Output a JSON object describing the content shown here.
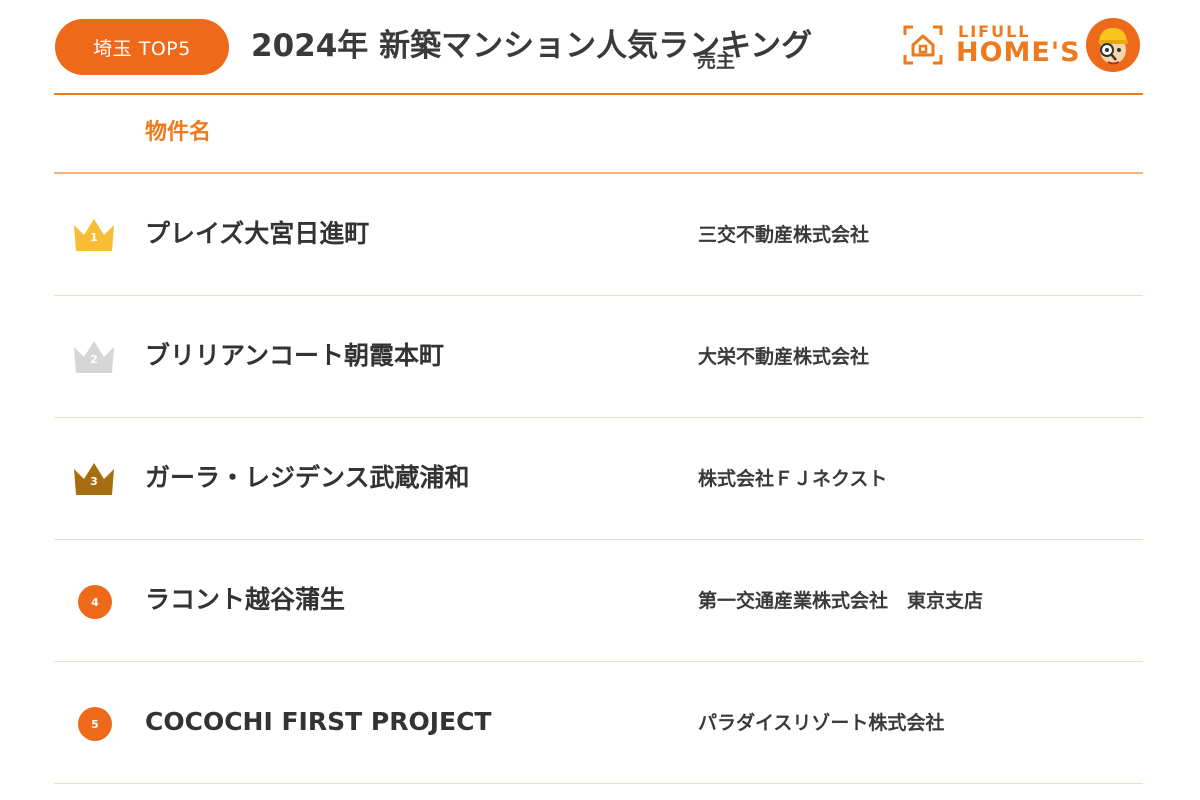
{
  "header": {
    "badge": "埼玉 TOP5",
    "title": "2024年 新築マンション人気ランキング",
    "logo_top": "LIFULL",
    "logo_main": "HOME'S"
  },
  "table": {
    "col_name": "物件名",
    "col_seller": "売主",
    "rows": [
      {
        "rank": "1",
        "marker": "gold-crown",
        "name": "プレイズ大宮日進町",
        "seller": "三交不動産株式会社"
      },
      {
        "rank": "2",
        "marker": "silver-crown",
        "name": "ブリリアンコート朝霞本町",
        "seller": "大栄不動産株式会社"
      },
      {
        "rank": "3",
        "marker": "bronze-crown",
        "name": "ガーラ・レジデンス武蔵浦和",
        "seller": "株式会社ＦＪネクスト"
      },
      {
        "rank": "4",
        "marker": "orange-circle",
        "name": "ラコント越谷蒲生",
        "seller": "第一交通産業株式会社　東京支店"
      },
      {
        "rank": "5",
        "marker": "orange-circle",
        "name": "COCOCHI FIRST PROJECT",
        "seller": "パラダイスリゾート株式会社"
      }
    ]
  },
  "colors": {
    "accent": "#ee6a1a",
    "gold": "#f7bd34",
    "silver": "#d6d6d6",
    "bronze": "#a86d10"
  }
}
